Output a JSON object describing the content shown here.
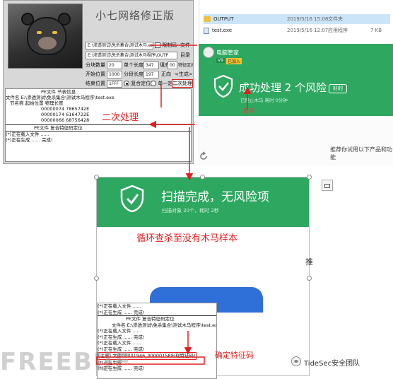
{
  "tool": {
    "title": "小七网络修正版",
    "path1": "E:\\渗透测试\\免杀集合\\测试木马.exe",
    "check_label": "限制码",
    "file_label": "文件",
    "path2": "E:\\渗透测试\\免杀集合\\测试木马程序\\OUTP",
    "dir_label": "目录",
    "split_count_label": "分块数量",
    "split_count_value": "20",
    "per_len_label": "单个长度",
    "per_len_value": "347",
    "fill_label": "填充",
    "fill_value": "00",
    "feature_label": "特征区间",
    "start_label": "开始位置",
    "start_value": "1000",
    "split_len_label": "分段长度",
    "split_len_value": "197",
    "forward_label": "正向",
    "generate_label": "<生成>",
    "end_label": "结束位置",
    "end_value": "1FFF",
    "compound_label": "复合定位",
    "single_label": "单一定位",
    "second_label": "二次处理",
    "log": [
      "PE文件 节表信息",
      "文件名 E:\\渗透测试\\免杀集合\\测试木马程序\\test.exe",
      "节名称    起始位置    物理长度",
      "00000074    7865742E",
      "00000174    6164722E",
      "00000066    68756428",
      "PE文件 复合特征码定位",
      "(*)正在载入文件 ......",
      "(*)正在生成 ...... 完成!"
    ]
  },
  "explorer": {
    "files": [
      {
        "name": "OUTPUT",
        "date": "2019/5/16 15:08",
        "type": "文件夹",
        "size": ""
      },
      {
        "name": "test.exe",
        "date": "2019/5/16 12:07",
        "type": "应用程序",
        "size": "7 KB"
      }
    ]
  },
  "guard1": {
    "app": "电脑管家",
    "badge1": "V9",
    "badge2": "已加入",
    "title": "成功处理 2 个风险",
    "button": "好的",
    "detail": "已阻止木马 耗时 0分钟",
    "recommend": "推荐你试用以下产品和功能"
  },
  "guard2": {
    "title": "扫描完成，无风险项",
    "subtitle": "扫描对象 20个，耗时 2秒",
    "side_text": "推",
    "log": [
      "(*)正在载入文件 ......",
      "(*)正在生成 ...... 完成!",
      "PE文件 复合特征码定位",
      "文件名 E:\\渗透测试\\免杀集合\\测试木马程序\\test.exe",
      "(*)正在载入文件 ......",
      "(*)正在生成 ...... 完成!",
      "(*)正在载入文件 ......",
      "(*)正在生成 ...... 完成!",
      "[注意] 文件00001946_00000158出现特征码!",
      "(*)正在生成 ......",
      "(*)正在生成 ...... 完成!"
    ]
  },
  "annotations": {
    "second": "二次处理",
    "loop": "循环查杀至没有木马样本",
    "confirm": "确定特征码",
    "stop": "查杀"
  },
  "watermark": "FREEBUF",
  "brand": "TideSec安全团队"
}
